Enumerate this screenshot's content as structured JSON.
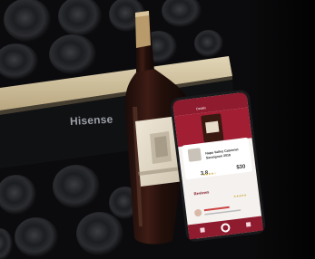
{
  "brand": {
    "logo_text": "Hisense"
  },
  "phone_app": {
    "header_title": "Details",
    "wine_name_line1": "Napa Valley Cabernet",
    "wine_name_line2": "Sauvignon 2018",
    "rating_value": "3.8",
    "rating_stars": "★★★★☆",
    "price": "$30",
    "reviews_heading": "Reviews",
    "review_stars": "★★★★★"
  },
  "colors": {
    "app_accent": "#8e1b2e",
    "shelf_wood": "#d6c7a5",
    "cabinet_dark": "#0b0b0d",
    "logo_gray": "#9a9ea4"
  }
}
